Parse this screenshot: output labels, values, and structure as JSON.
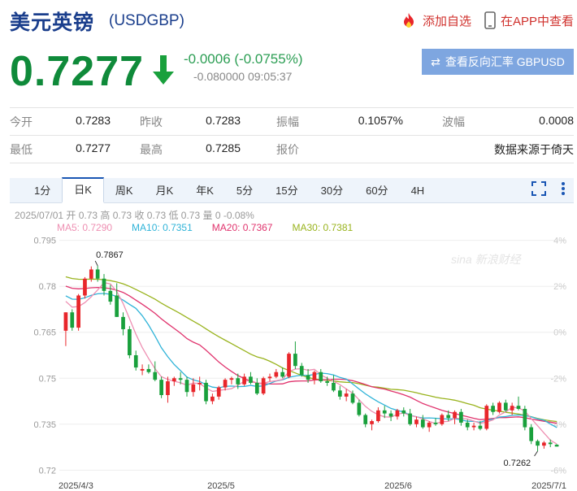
{
  "header": {
    "title": "美元英镑",
    "code": "(USDGBP)",
    "add_watch": "添加自选",
    "app_view": "在APP中查看"
  },
  "quote": {
    "price": "0.7277",
    "change": "-0.0006 (-0.0755%)",
    "sub": "-0.080000 09:05:37",
    "reverse_button": "查看反向汇率 GBPUSD"
  },
  "stats": [
    [
      {
        "k": "今开",
        "v": "0.7283"
      },
      {
        "k": "昨收",
        "v": "0.7283"
      },
      {
        "k": "振幅",
        "v": "0.1057%"
      },
      {
        "k": "波幅",
        "v": "0.0008"
      }
    ],
    [
      {
        "k": "最低",
        "v": "0.7277"
      },
      {
        "k": "最高",
        "v": "0.7285"
      },
      {
        "k": "报价",
        "v": ""
      },
      {
        "k": "",
        "v": "数据来源于倚天"
      }
    ]
  ],
  "tabs": [
    "1分",
    "日K",
    "周K",
    "月K",
    "年K",
    "5分",
    "15分",
    "30分",
    "60分",
    "4H"
  ],
  "active_tab": "日K",
  "info": {
    "line1": "2025/07/01 开 0.73 高 0.73 收 0.73 低 0.73 量 0 -0.08%",
    "ma5": "MA5: 0.7290",
    "ma10": "MA10: 0.7351",
    "ma20": "MA20: 0.7367",
    "ma30": "MA30: 0.7381"
  },
  "watermark": "sina 新浪财经",
  "colors": {
    "up": "#e8262b",
    "down": "#19a03c",
    "ma5": "#ee8fb2",
    "ma10": "#2fb3d8",
    "ma20": "#e0336d",
    "ma30": "#99b31d",
    "brand": "#1a3e8c"
  },
  "chart_data": {
    "type": "candlestick",
    "ylim": [
      0.7185,
      0.7965
    ],
    "y_ticks": [
      "0.795",
      "0.78",
      "0.765",
      "0.75",
      "0.735",
      "0.72"
    ],
    "y_right_ticks": [
      "4%",
      "2%",
      "0%",
      "-2%",
      "-4%",
      "-6%"
    ],
    "x_labels": [
      "2025/4/3",
      "2025/5",
      "2025/6",
      "2025/7/1"
    ],
    "annotations": [
      {
        "text": "0.7867",
        "value": 0.7867
      },
      {
        "text": "0.7262",
        "value": 0.7262
      }
    ],
    "candles": [
      [
        0.7655,
        0.7715,
        0.7605,
        0.7715
      ],
      [
        0.7715,
        0.7725,
        0.7655,
        0.7665
      ],
      [
        0.7665,
        0.7775,
        0.7655,
        0.777
      ],
      [
        0.777,
        0.783,
        0.776,
        0.7825
      ],
      [
        0.7825,
        0.7865,
        0.7815,
        0.7855
      ],
      [
        0.7855,
        0.7867,
        0.7815,
        0.7825
      ],
      [
        0.7825,
        0.784,
        0.777,
        0.7785
      ],
      [
        0.7785,
        0.7805,
        0.774,
        0.775
      ],
      [
        0.777,
        0.781,
        0.77,
        0.77
      ],
      [
        0.77,
        0.7715,
        0.764,
        0.766
      ],
      [
        0.766,
        0.767,
        0.7565,
        0.7575
      ],
      [
        0.7575,
        0.759,
        0.7525,
        0.7535
      ],
      [
        0.7525,
        0.7545,
        0.751,
        0.753
      ],
      [
        0.753,
        0.7545,
        0.7515,
        0.752
      ],
      [
        0.752,
        0.7555,
        0.749,
        0.7495
      ],
      [
        0.7495,
        0.7505,
        0.7435,
        0.7445
      ],
      [
        0.7445,
        0.7505,
        0.742,
        0.749
      ],
      [
        0.749,
        0.7505,
        0.7475,
        0.75
      ],
      [
        0.75,
        0.752,
        0.748,
        0.7495
      ],
      [
        0.7495,
        0.7505,
        0.744,
        0.7455
      ],
      [
        0.7455,
        0.75,
        0.744,
        0.748
      ],
      [
        0.748,
        0.7505,
        0.746,
        0.7485
      ],
      [
        0.7485,
        0.7495,
        0.7415,
        0.7425
      ],
      [
        0.7425,
        0.745,
        0.7415,
        0.744
      ],
      [
        0.744,
        0.7475,
        0.743,
        0.747
      ],
      [
        0.747,
        0.75,
        0.746,
        0.7495
      ],
      [
        0.7495,
        0.7505,
        0.748,
        0.75
      ],
      [
        0.75,
        0.7515,
        0.7465,
        0.748
      ],
      [
        0.748,
        0.7515,
        0.7475,
        0.7505
      ],
      [
        0.7505,
        0.752,
        0.748,
        0.7485
      ],
      [
        0.7485,
        0.75,
        0.7445,
        0.745
      ],
      [
        0.745,
        0.7505,
        0.7445,
        0.75
      ],
      [
        0.75,
        0.7515,
        0.749,
        0.7505
      ],
      [
        0.7505,
        0.753,
        0.75,
        0.752
      ],
      [
        0.752,
        0.7535,
        0.75,
        0.7505
      ],
      [
        0.7505,
        0.7585,
        0.75,
        0.758
      ],
      [
        0.758,
        0.762,
        0.753,
        0.754
      ],
      [
        0.754,
        0.755,
        0.7505,
        0.751
      ],
      [
        0.751,
        0.753,
        0.7485,
        0.7495
      ],
      [
        0.7495,
        0.7525,
        0.748,
        0.752
      ],
      [
        0.752,
        0.753,
        0.7485,
        0.749
      ],
      [
        0.749,
        0.7505,
        0.7475,
        0.7485
      ],
      [
        0.7485,
        0.751,
        0.7455,
        0.746
      ],
      [
        0.746,
        0.7475,
        0.743,
        0.744
      ],
      [
        0.744,
        0.7465,
        0.7425,
        0.745
      ],
      [
        0.745,
        0.746,
        0.7415,
        0.742
      ],
      [
        0.742,
        0.743,
        0.7375,
        0.738
      ],
      [
        0.738,
        0.7385,
        0.734,
        0.735
      ],
      [
        0.735,
        0.7365,
        0.733,
        0.736
      ],
      [
        0.736,
        0.7405,
        0.7355,
        0.7395
      ],
      [
        0.7395,
        0.741,
        0.737,
        0.7385
      ],
      [
        0.7385,
        0.7395,
        0.736,
        0.7375
      ],
      [
        0.7375,
        0.74,
        0.7365,
        0.7395
      ],
      [
        0.7395,
        0.7405,
        0.7375,
        0.7385
      ],
      [
        0.7385,
        0.74,
        0.7345,
        0.735
      ],
      [
        0.735,
        0.7375,
        0.734,
        0.7365
      ],
      [
        0.7365,
        0.738,
        0.7335,
        0.734
      ],
      [
        0.734,
        0.736,
        0.7325,
        0.7355
      ],
      [
        0.7355,
        0.737,
        0.7345,
        0.735
      ],
      [
        0.735,
        0.7385,
        0.7345,
        0.738
      ],
      [
        0.738,
        0.7395,
        0.736,
        0.737
      ],
      [
        0.737,
        0.7395,
        0.735,
        0.739
      ],
      [
        0.739,
        0.74,
        0.7345,
        0.7355
      ],
      [
        0.7355,
        0.7365,
        0.733,
        0.734
      ],
      [
        0.734,
        0.7355,
        0.733,
        0.7345
      ],
      [
        0.7345,
        0.736,
        0.733,
        0.7335
      ],
      [
        0.7335,
        0.7415,
        0.733,
        0.741
      ],
      [
        0.741,
        0.742,
        0.738,
        0.739
      ],
      [
        0.739,
        0.7425,
        0.7385,
        0.742
      ],
      [
        0.742,
        0.743,
        0.739,
        0.7395
      ],
      [
        0.7395,
        0.742,
        0.738,
        0.741
      ],
      [
        0.741,
        0.744,
        0.7395,
        0.74
      ],
      [
        0.74,
        0.741,
        0.733,
        0.734
      ],
      [
        0.734,
        0.735,
        0.7285,
        0.7295
      ],
      [
        0.7295,
        0.73,
        0.7262,
        0.728
      ],
      [
        0.728,
        0.7295,
        0.727,
        0.729
      ],
      [
        0.729,
        0.73,
        0.7275,
        0.7285
      ],
      [
        0.7283,
        0.7285,
        0.7277,
        0.7277
      ]
    ]
  }
}
